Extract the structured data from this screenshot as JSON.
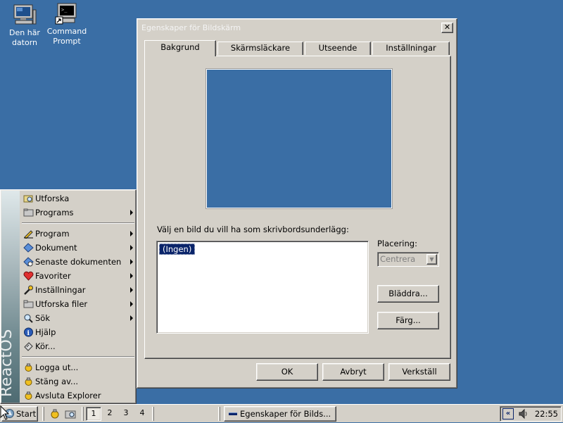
{
  "desktop": {
    "icons": [
      {
        "label_line1": "Den här",
        "label_line2": "datorn",
        "icon": "computer-icon"
      },
      {
        "label_line1": "Command",
        "label_line2": "Prompt",
        "icon": "terminal-icon"
      }
    ],
    "background_color": "#3a6ea5"
  },
  "dialog": {
    "title": "Egenskaper för Bildskärm",
    "tabs": [
      {
        "label": "Bakgrund",
        "active": true
      },
      {
        "label": "Skärmsläckare",
        "active": false
      },
      {
        "label": "Utseende",
        "active": false
      },
      {
        "label": "Inställningar",
        "active": false
      }
    ],
    "wallpaper_prompt": "Välj en bild du vill ha som skrivbordsunderlägg:",
    "wallpaper_list": [
      "(Ingen)"
    ],
    "placement_label": "Placering:",
    "placement_value": "Centrera",
    "browse_button": "Bläddra...",
    "color_button": "Färg...",
    "ok_button": "OK",
    "cancel_button": "Avbryt",
    "apply_button": "Verkställ"
  },
  "start_menu": {
    "banner_text": "ReactOS",
    "top_items": [
      {
        "label": "Utforska",
        "icon": "explore-icon",
        "submenu": false
      },
      {
        "label": "Programs",
        "icon": "programs-folder-icon",
        "submenu": true
      }
    ],
    "middle_items": [
      {
        "label": "Program",
        "icon": "pen-icon",
        "submenu": true
      },
      {
        "label": "Dokument",
        "icon": "documents-icon",
        "submenu": true
      },
      {
        "label": "Senaste dokumenten",
        "icon": "recent-documents-icon",
        "submenu": true
      },
      {
        "label": "Favoriter",
        "icon": "heart-icon",
        "submenu": true
      },
      {
        "label": "Inställningar",
        "icon": "wrench-icon",
        "submenu": true
      },
      {
        "label": "Utforska filer",
        "icon": "folder-icon",
        "submenu": true
      },
      {
        "label": "Sök",
        "icon": "search-icon",
        "submenu": true
      },
      {
        "label": "Hjälp",
        "icon": "help-icon",
        "submenu": false
      },
      {
        "label": "Kör...",
        "icon": "run-icon",
        "submenu": false
      }
    ],
    "bottom_items": [
      {
        "label": "Logga ut...",
        "icon": "logout-icon"
      },
      {
        "label": "Stäng av...",
        "icon": "shutdown-icon"
      },
      {
        "label": "Avsluta Explorer",
        "icon": "exit-icon"
      }
    ]
  },
  "taskbar": {
    "start_label": "Start",
    "workspaces": [
      "1",
      "2",
      "3",
      "4"
    ],
    "active_workspace": "1",
    "task_label": "Egenskaper för Bilds...",
    "clock": "22:55"
  }
}
